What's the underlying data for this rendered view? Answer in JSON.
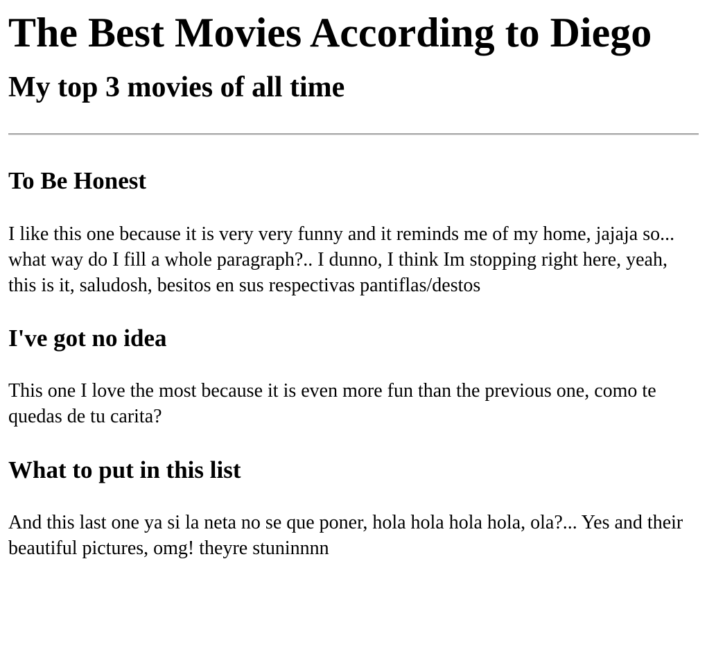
{
  "page": {
    "title": "The Best Movies According to Diego",
    "subtitle": "My top 3 movies of all time"
  },
  "movies": [
    {
      "title": "To Be Honest",
      "description": "I like this one because it is very very funny and it reminds me of my home, jajaja so... what way do I fill a whole paragraph?.. I dunno, I think Im stopping right here, yeah, this is it, saludosh, besitos en sus respectivas pantiflas/destos"
    },
    {
      "title": "I've got no idea",
      "description": "This one I love the most because it is even more fun than the previous one, como te quedas de tu carita?"
    },
    {
      "title": "What to put in this list",
      "description": "And this last one ya si la neta no se que poner, hola hola hola hola, ola?... Yes and their beautiful pictures, omg! theyre stuninnnn"
    }
  ]
}
